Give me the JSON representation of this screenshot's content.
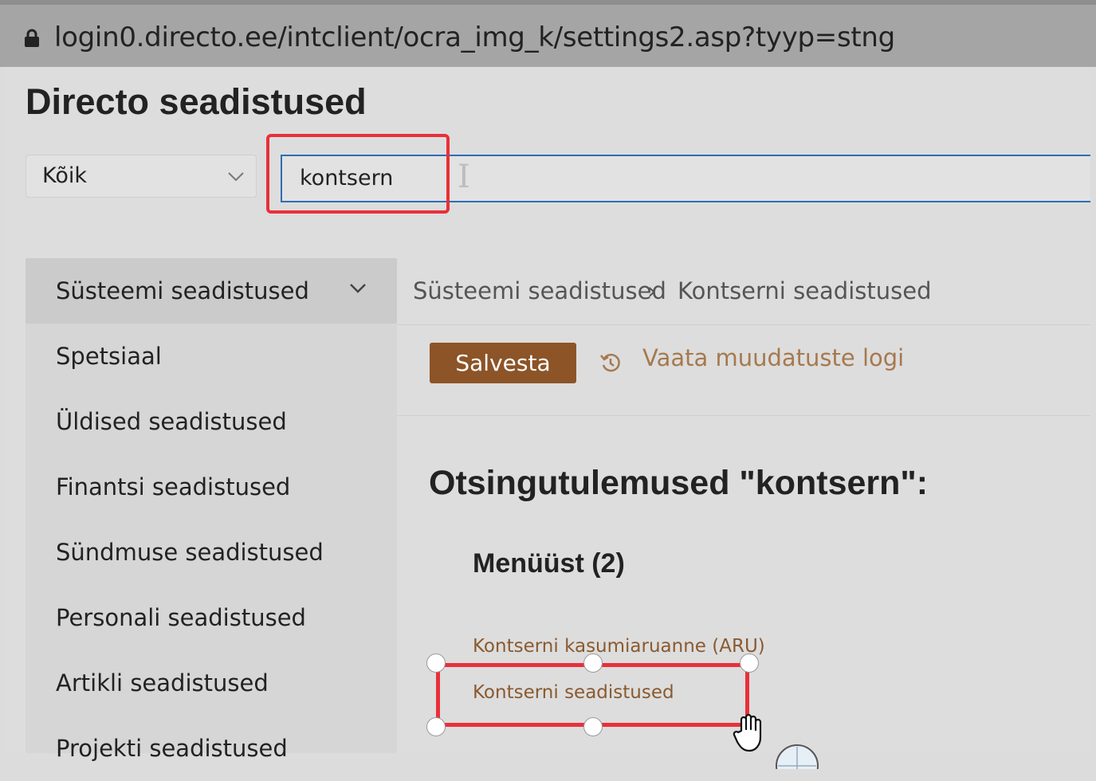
{
  "browser": {
    "url": "login0.directo.ee/intclient/ocra_img_k/settings2.asp?tyyp=stng"
  },
  "page": {
    "title": "Directo seadistused",
    "filter": {
      "selected": "Kõik"
    },
    "search": {
      "value": "kontsern"
    }
  },
  "sidebar": {
    "items": [
      {
        "label": "Süsteemi seadistused",
        "active": true
      },
      {
        "label": "Spetsiaal"
      },
      {
        "label": "Üldised seadistused"
      },
      {
        "label": "Finantsi seadistused"
      },
      {
        "label": "Sündmuse seadistused"
      },
      {
        "label": "Personali seadistused"
      },
      {
        "label": "Artikli seadistused"
      },
      {
        "label": "Projekti seadistused"
      }
    ]
  },
  "breadcrumb": {
    "parent": "Süsteemi seadistused",
    "separator": "›",
    "current": "Kontserni seadistused"
  },
  "toolbar": {
    "save_label": "Salvesta",
    "log_label": "Vaata muudatuste logi"
  },
  "results": {
    "title": "Otsingutulemused \"kontsern\":",
    "section": "Menüüst (2)",
    "items": [
      "Kontserni kasumiaruanne (ARU)",
      "Kontserni seadistused"
    ]
  },
  "colors": {
    "accent": "#8c5427",
    "link": "#a6794f",
    "highlight": "#e8303a",
    "focus": "#2b6fb3"
  }
}
